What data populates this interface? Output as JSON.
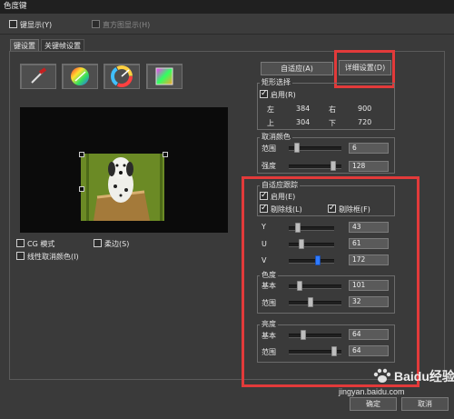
{
  "window": {
    "title": "色度键"
  },
  "topbar": {
    "key_display": "键显示(Y)",
    "histogram_display": "直方图显示(H)"
  },
  "tabs": [
    {
      "label": "键设置"
    },
    {
      "label": "关键帧设置"
    }
  ],
  "buttons": {
    "adaptive": "自适应(A)",
    "details": "详细设置(D)",
    "ok": "确定",
    "cancel": "取消"
  },
  "rect_select": {
    "title": "矩形选择",
    "enable": "启用(R)",
    "left_label": "左",
    "left": "384",
    "right_label": "右",
    "right": "900",
    "top_label": "上",
    "top": "304",
    "bottom_label": "下",
    "bottom": "720"
  },
  "cancel_color": {
    "title": "取消颜色",
    "range_label": "范围",
    "range": "6",
    "range_pos": 0.12,
    "strength_label": "强度",
    "strength": "128",
    "strength_pos": 0.88
  },
  "adaptive_track": {
    "title": "自适应跟踪",
    "enable": "启用(E)",
    "remove_line": "剔除线(L)",
    "remove_frame": "剔除框(F)",
    "y_label": "Y",
    "y": "43",
    "y_pos": 0.17,
    "u_label": "U",
    "u": "61",
    "u_pos": 0.24,
    "v_label": "V",
    "v": "172",
    "v_pos": 0.67
  },
  "hue": {
    "title": "色度",
    "base_label": "基本",
    "base": "101",
    "base_pos": 0.18,
    "range_label": "范围",
    "range": "32",
    "range_pos": 0.4
  },
  "brightness": {
    "title": "亮度",
    "base_label": "基本",
    "base": "64",
    "base_pos": 0.25,
    "range_label": "范围",
    "range": "64",
    "range_pos": 0.9
  },
  "options": {
    "cg_mode": "CG 模式",
    "soft_edge": "柔边(S)",
    "linear_cancel": "线性取消颜色(I)"
  },
  "icons": [
    "eyedropper-icon",
    "color-wheel-icon",
    "hue-wheel-icon",
    "color-gradient-icon"
  ],
  "watermark": {
    "brand": "Baidu经验",
    "url": "jingyan.baidu.com"
  },
  "colors": {
    "highlight": "#e23a3a",
    "accent": "#2f7bff",
    "backdrop": "#6b8a25"
  }
}
